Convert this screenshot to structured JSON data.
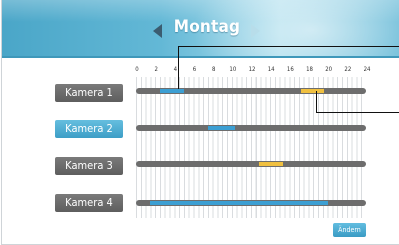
{
  "header": {
    "day": "Montag"
  },
  "timeline": {
    "hour_labels": [
      "0",
      "2",
      "4",
      "6",
      "8",
      "10",
      "12",
      "14",
      "16",
      "18",
      "20",
      "22",
      "24"
    ],
    "hour_range": [
      0,
      24
    ]
  },
  "cameras": [
    {
      "label": "Kamera 1",
      "selected": false,
      "segments": [
        {
          "start_hour": 2.5,
          "end_hour": 5.0,
          "color": "#3c9fd3"
        },
        {
          "start_hour": 17.2,
          "end_hour": 19.6,
          "color": "#f0c040"
        }
      ]
    },
    {
      "label": "Kamera 2",
      "selected": true,
      "segments": [
        {
          "start_hour": 7.5,
          "end_hour": 10.3,
          "color": "#3c9fd3"
        }
      ]
    },
    {
      "label": "Kamera 3",
      "selected": false,
      "segments": [
        {
          "start_hour": 12.8,
          "end_hour": 15.3,
          "color": "#f0c040"
        }
      ]
    },
    {
      "label": "Kamera 4",
      "selected": false,
      "segments": [
        {
          "start_hour": 1.5,
          "end_hour": 20.0,
          "color": "#3c9fd3"
        }
      ]
    }
  ],
  "actions": {
    "change_label": "Ändern"
  },
  "colors": {
    "header_blue": "#63b8d6",
    "selected_blue": "#3d9ec6",
    "recording_blue": "#3c9fd3",
    "recording_yellow": "#f0c040",
    "track_gray": "#6d6d6d"
  }
}
